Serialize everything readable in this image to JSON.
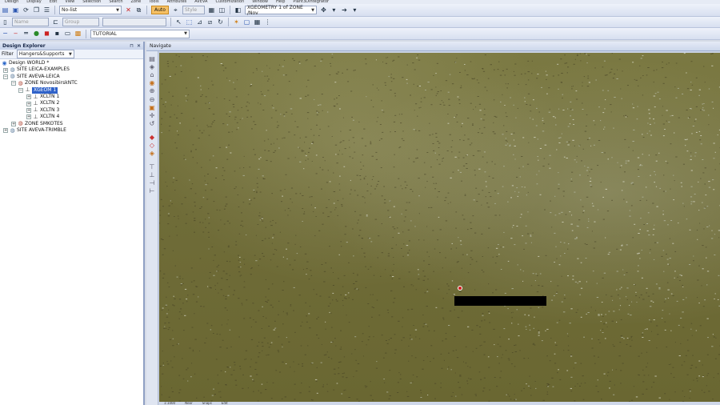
{
  "menubar": {
    "items": [
      "Design",
      "Display",
      "Edit",
      "View",
      "Selection",
      "Search",
      "Zone",
      "Tools",
      "Attributes",
      "AVEVA",
      "Customization",
      "Window",
      "Help",
      "Plant3DIntegrator"
    ]
  },
  "toolbar1": {
    "filter_combo_value": "No-list",
    "orange_toggle_label": "Auto",
    "style_combo_placeholder": "Style",
    "geometry_combo_value": "XGEOMETRY 1 of ZONE /Nov"
  },
  "toolbar2": {
    "combo_a_placeholder": "Name",
    "combo_b_placeholder": "Group"
  },
  "toolbar3": {
    "tutorial_combo_value": "TUTORIAL"
  },
  "explorer": {
    "title": "Design Explorer",
    "filter_label": "Filter",
    "filter_value": "Hangers&Supports",
    "tree": [
      {
        "label": "Design WORLD *"
      },
      {
        "label": "SITE LEICA-EXAMPLES"
      },
      {
        "label": "SITE AVEVA-LEICA"
      },
      {
        "label": "ZONE NovosibirskNTC"
      },
      {
        "label": "XGEOM 1"
      },
      {
        "label": "XCLTN 1"
      },
      {
        "label": "XCLTN 2"
      },
      {
        "label": "XCLTN 3"
      },
      {
        "label": "XCLTN 4"
      },
      {
        "label": "ZONE SMKOTES"
      },
      {
        "label": "SITE AVEVA-TRIMBLE"
      }
    ]
  },
  "viewport": {
    "title": "Navigate"
  },
  "statusbar": {
    "items": [
      "1:1000",
      "Near",
      "Snaps",
      "Edit"
    ]
  },
  "colors": {
    "pointcloud_base": "#6f6c38",
    "selection": "#2f62c9",
    "panel_border": "#8fa0c4"
  }
}
